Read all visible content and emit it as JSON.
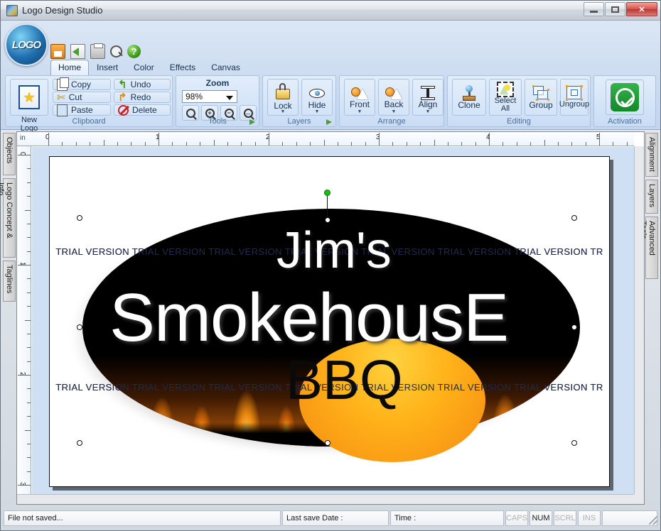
{
  "window": {
    "title": "Logo Design Studio",
    "icon": "app-logo-icon",
    "minimize_label": "",
    "restore_label": "",
    "close_label": "✕"
  },
  "quick_access": [
    {
      "name": "save-icon",
      "label": "Save"
    },
    {
      "name": "open-icon",
      "label": "Open"
    },
    {
      "name": "print-icon",
      "label": "Print"
    },
    {
      "name": "print-preview-icon",
      "label": "Print Preview"
    },
    {
      "name": "help-icon",
      "label": "?"
    }
  ],
  "app_button": {
    "label": "LOGO"
  },
  "tabs": [
    {
      "label": "Home",
      "active": true
    },
    {
      "label": "Insert",
      "active": false
    },
    {
      "label": "Color",
      "active": false
    },
    {
      "label": "Effects",
      "active": false
    },
    {
      "label": "Canvas",
      "active": false
    }
  ],
  "ribbon": {
    "groups": [
      {
        "label": "Clipboard"
      },
      {
        "label": "Tools"
      },
      {
        "label": "Layers"
      },
      {
        "label": "Arrange"
      },
      {
        "label": "Editing"
      },
      {
        "label": "Activation"
      }
    ],
    "new_logo": "New\nLogo",
    "new_logo_line1": "New",
    "new_logo_line2": "Logo",
    "copy": "Copy",
    "cut": "Cut",
    "paste": "Paste",
    "undo": "Undo",
    "redo": "Redo",
    "delete": "Delete",
    "zoom_title": "Zoom",
    "zoom_value": "98%",
    "zoom_buttons": [
      "zoom-select",
      "zoom-in",
      "zoom-out",
      "zoom-fit"
    ],
    "lock": "Lock",
    "hide": "Hide",
    "front": "Front",
    "back": "Back",
    "align": "Align",
    "clone": "Clone",
    "select_all_line1": "Select",
    "select_all_line2": "All",
    "group": "Group",
    "ungroup": "Ungroup",
    "chevron": "▼"
  },
  "left_tabs": [
    {
      "label": "Objects"
    },
    {
      "label": "Logo Concept & Info"
    },
    {
      "label": "Taglines"
    }
  ],
  "right_tabs": [
    {
      "label": "Alignment"
    },
    {
      "label": "Layers"
    },
    {
      "label": "Advanced Tools"
    }
  ],
  "rulers": {
    "unit": "in",
    "horizontal_marks": [
      "0",
      "1",
      "2",
      "3",
      "4",
      "5"
    ],
    "vertical_marks": [
      "0",
      "1",
      "2",
      "3"
    ]
  },
  "canvas": {
    "watermark_text": "TRIAL VERSION",
    "watermark_row1": "TRIAL VERSION   TRIAL VERSION   TRIAL VERSION   TRIAL VERSION   TRIAL VERSION   TRIAL VERSION   TRIAL VERSION   TR",
    "watermark_row2": "TRIAL VERSION   TRIAL VERSION   TRIAL VERSION   TRIAL VERSION   TRIAL VERSION   TRIAL VERSION   TRIAL VERSION   TR",
    "logo": {
      "line1": "Jim's",
      "line2": "SmokehousE",
      "line3": "BBQ"
    },
    "colors": {
      "ellipse": "#000000",
      "badge_top": "#ffd23f",
      "badge_bottom": "#f58a12",
      "flame_hot": "#fff07a",
      "flame_mid": "#e8800c",
      "text": "#ffffff",
      "badge_text": "#0a0a0a",
      "watermark": "#202a4a",
      "rotate_handle": "#12c412"
    }
  },
  "statusbar": {
    "message": "File not saved...",
    "last_save_label": "Last save Date :",
    "time_label": "Time :",
    "indicators": [
      {
        "label": "CAPS",
        "active": false
      },
      {
        "label": "NUM",
        "active": true
      },
      {
        "label": "SCRL",
        "active": false
      },
      {
        "label": "INS",
        "active": false
      }
    ]
  }
}
